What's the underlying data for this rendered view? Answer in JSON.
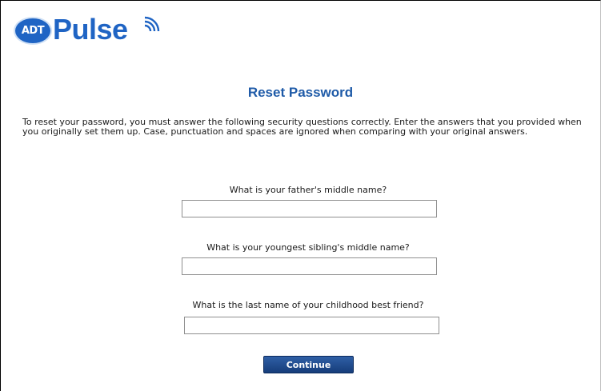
{
  "logo": {
    "badge": "ADT",
    "word": "Pulse"
  },
  "page_title": "Reset Password",
  "intro_text": "To reset your password, you must answer the following security questions correctly. Enter the answers that you provided when you originally set them up. Case, punctuation and spaces are ignored when comparing with your original answers.",
  "questions": [
    {
      "label": "What is your father's middle name?",
      "value": ""
    },
    {
      "label": "What is your youngest sibling's middle name?",
      "value": ""
    },
    {
      "label": "What is the last name of your childhood best friend?",
      "value": ""
    }
  ],
  "continue_label": "Continue",
  "colors": {
    "brand_blue": "#1f64c4",
    "title_blue": "#1f5ba8",
    "button_blue": "#163d7a"
  }
}
